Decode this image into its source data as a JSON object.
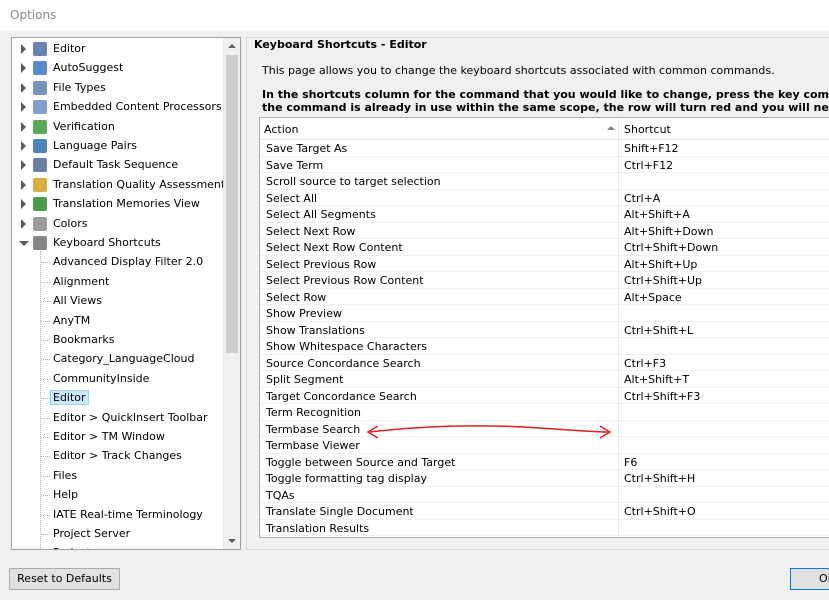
{
  "window": {
    "title": "Options"
  },
  "tree": {
    "items": [
      {
        "label": "Editor",
        "icon": "pencil-icon",
        "type": "collapsed"
      },
      {
        "label": "AutoSuggest",
        "icon": "autosuggest-icon",
        "type": "collapsed"
      },
      {
        "label": "File Types",
        "icon": "file-types-icon",
        "type": "collapsed"
      },
      {
        "label": "Embedded Content Processors",
        "icon": "embedded-content-icon",
        "type": "collapsed"
      },
      {
        "label": "Verification",
        "icon": "verification-icon",
        "type": "collapsed"
      },
      {
        "label": "Language Pairs",
        "icon": "language-pairs-icon",
        "type": "collapsed"
      },
      {
        "label": "Default Task Sequence",
        "icon": "task-sequence-icon",
        "type": "collapsed"
      },
      {
        "label": "Translation Quality Assessment",
        "icon": "quality-assessment-icon",
        "type": "collapsed"
      },
      {
        "label": "Translation Memories View",
        "icon": "translation-memories-icon",
        "type": "collapsed"
      },
      {
        "label": "Colors",
        "icon": "palette-icon",
        "type": "collapsed"
      },
      {
        "label": "Keyboard Shortcuts",
        "icon": "keyboard-icon",
        "type": "expanded"
      },
      {
        "label": "Advanced Display Filter 2.0",
        "type": "child"
      },
      {
        "label": "Alignment",
        "type": "child"
      },
      {
        "label": "All Views",
        "type": "child"
      },
      {
        "label": "AnyTM",
        "type": "child"
      },
      {
        "label": "Bookmarks",
        "type": "child"
      },
      {
        "label": "Category_LanguageCloud",
        "type": "child"
      },
      {
        "label": "CommunityInside",
        "type": "child"
      },
      {
        "label": "Editor",
        "type": "child",
        "selected": true
      },
      {
        "label": "Editor > QuickInsert Toolbar",
        "type": "child"
      },
      {
        "label": "Editor > TM Window",
        "type": "child"
      },
      {
        "label": "Editor > Track Changes",
        "type": "child"
      },
      {
        "label": "Files",
        "type": "child"
      },
      {
        "label": "Help",
        "type": "child"
      },
      {
        "label": "IATE Real-time Terminology",
        "type": "child"
      },
      {
        "label": "Project Server",
        "type": "child"
      },
      {
        "label": "Projects",
        "type": "child"
      }
    ]
  },
  "page": {
    "title": "Keyboard Shortcuts - Editor",
    "description": "This page allows you to change the keyboard shortcuts associated with common commands.",
    "instructions_line1": "In the shortcuts column for the command that you would like to change, press the key combination that you would like to use.",
    "instructions_line2": "the command is already in use within the same scope, the row will turn red and you will need to enter a different shortcut."
  },
  "grid": {
    "col_action": "Action",
    "col_shortcut": "Shortcut",
    "rows": [
      {
        "action": "Save Target As",
        "shortcut": "Shift+F12"
      },
      {
        "action": "Save Term",
        "shortcut": "Ctrl+F12"
      },
      {
        "action": "Scroll source to target selection",
        "shortcut": ""
      },
      {
        "action": "Select All",
        "shortcut": "Ctrl+A"
      },
      {
        "action": "Select All Segments",
        "shortcut": "Alt+Shift+A"
      },
      {
        "action": "Select Next Row",
        "shortcut": "Alt+Shift+Down"
      },
      {
        "action": "Select Next Row Content",
        "shortcut": "Ctrl+Shift+Down"
      },
      {
        "action": "Select Previous Row",
        "shortcut": "Alt+Shift+Up"
      },
      {
        "action": "Select Previous Row Content",
        "shortcut": "Ctrl+Shift+Up"
      },
      {
        "action": "Select Row",
        "shortcut": "Alt+Space"
      },
      {
        "action": "Show Preview",
        "shortcut": ""
      },
      {
        "action": "Show Translations",
        "shortcut": "Ctrl+Shift+L"
      },
      {
        "action": "Show Whitespace Characters",
        "shortcut": ""
      },
      {
        "action": "Source Concordance Search",
        "shortcut": "Ctrl+F3"
      },
      {
        "action": "Split Segment",
        "shortcut": "Alt+Shift+T"
      },
      {
        "action": "Target Concordance Search",
        "shortcut": "Ctrl+Shift+F3"
      },
      {
        "action": "Term Recognition",
        "shortcut": ""
      },
      {
        "action": "Termbase Search",
        "shortcut": ""
      },
      {
        "action": "Termbase Viewer",
        "shortcut": ""
      },
      {
        "action": "Toggle between Source and Target",
        "shortcut": "F6"
      },
      {
        "action": "Toggle formatting tag display",
        "shortcut": "Ctrl+Shift+H"
      },
      {
        "action": "TQAs",
        "shortcut": ""
      },
      {
        "action": "Translate Single Document",
        "shortcut": "Ctrl+Shift+O"
      },
      {
        "action": "Translation Results",
        "shortcut": ""
      }
    ]
  },
  "buttons": {
    "reset": "Reset to Defaults",
    "ok": "OK"
  },
  "annotation_color": "#e02020"
}
